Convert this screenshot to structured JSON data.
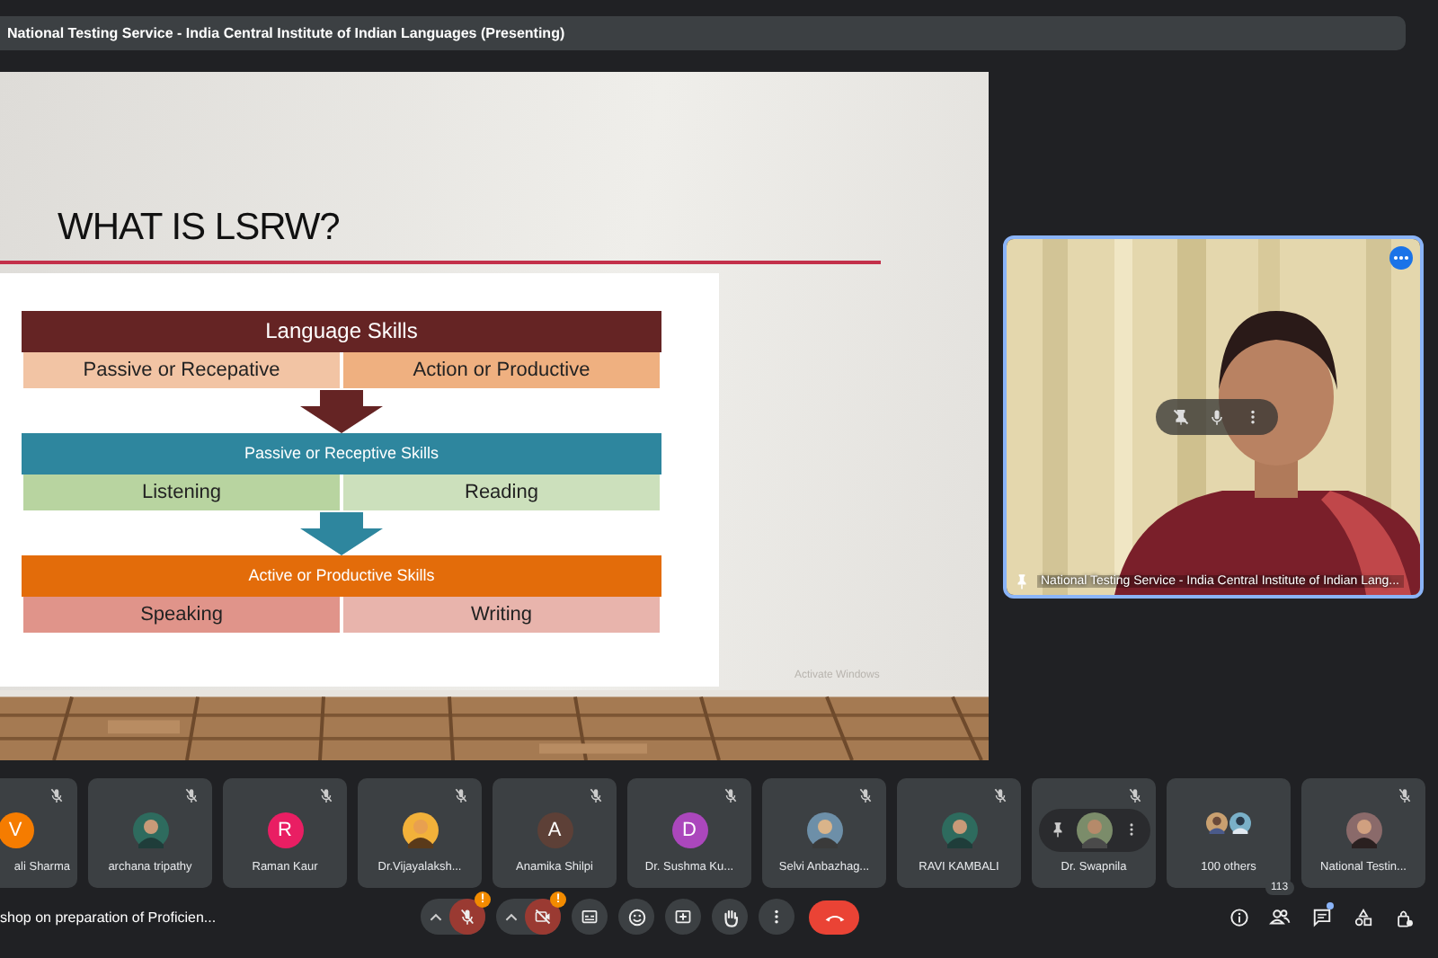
{
  "presenter_banner": {
    "title": "National Testing Service - India Central Institute of Indian Languages (Presenting)"
  },
  "slide": {
    "title": "WHAT IS LSRW?",
    "os_notice": "Activate Windows",
    "sections": [
      {
        "heading": "Language Skills",
        "color": "#652424",
        "cells": [
          {
            "text": "Passive or Recepative",
            "color": "#f2c4a4"
          },
          {
            "text": "Action or Productive",
            "color": "#efb080"
          }
        ]
      },
      {
        "heading": "Passive or Receptive Skills",
        "color": "#2e869e",
        "cells": [
          {
            "text": "Listening",
            "color": "#b8d4a0"
          },
          {
            "text": "Reading",
            "color": "#cce0bc"
          }
        ]
      },
      {
        "heading": "Active or Productive Skills",
        "color": "#e36c0a",
        "cells": [
          {
            "text": "Speaking",
            "color": "#e0948a"
          },
          {
            "text": "Writing",
            "color": "#e8b4ac"
          }
        ]
      }
    ]
  },
  "speaker_tile": {
    "name": "National Testing Service - India Central Institute of Indian Lang...",
    "pinned": true
  },
  "participants": [
    {
      "name": "ali Sharma",
      "muted": true,
      "hovered": false,
      "avatar": {
        "kind": "letter",
        "letter": "V",
        "color": "#f57c00"
      }
    },
    {
      "name": "archana tripathy",
      "muted": true,
      "hovered": false
    },
    {
      "name": "Raman Kaur",
      "muted": true,
      "hovered": false,
      "avatar": {
        "kind": "letter",
        "letter": "R",
        "color": "#e91e63"
      }
    },
    {
      "name": "Dr.Vijayalaksh...",
      "muted": true,
      "hovered": false
    },
    {
      "name": "Anamika Shilpi",
      "muted": true,
      "hovered": false,
      "avatar": {
        "kind": "letter",
        "letter": "A",
        "color": "#5d4037"
      }
    },
    {
      "name": "Dr. Sushma Ku...",
      "muted": true,
      "hovered": false,
      "avatar": {
        "kind": "letter",
        "letter": "D",
        "color": "#ab47bc"
      }
    },
    {
      "name": "Selvi Anbazhag...",
      "muted": true,
      "hovered": false
    },
    {
      "name": "RAVI KAMBALI",
      "muted": true,
      "hovered": false
    },
    {
      "name": "Dr. Swapnila",
      "muted": true,
      "hovered": true
    },
    {
      "name": "100 others",
      "muted": false,
      "hovered": false,
      "avatar": {
        "kind": "group"
      }
    },
    {
      "name": "National Testin...",
      "muted": true,
      "hovered": false
    }
  ],
  "bottom_bar": {
    "meeting_title": "shop on preparation of Proficien...",
    "controls": [
      {
        "kind": "mic",
        "on": false,
        "badge": "!"
      },
      {
        "kind": "camera",
        "on": false,
        "badge": "!"
      },
      {
        "kind": "captions"
      },
      {
        "kind": "emoji"
      },
      {
        "kind": "present"
      },
      {
        "kind": "hand"
      },
      {
        "kind": "more"
      },
      {
        "kind": "end"
      }
    ],
    "side_buttons": [
      {
        "kind": "info"
      },
      {
        "kind": "people",
        "count": "113"
      },
      {
        "kind": "chat",
        "unread": true
      },
      {
        "kind": "activities"
      },
      {
        "kind": "host"
      }
    ]
  }
}
